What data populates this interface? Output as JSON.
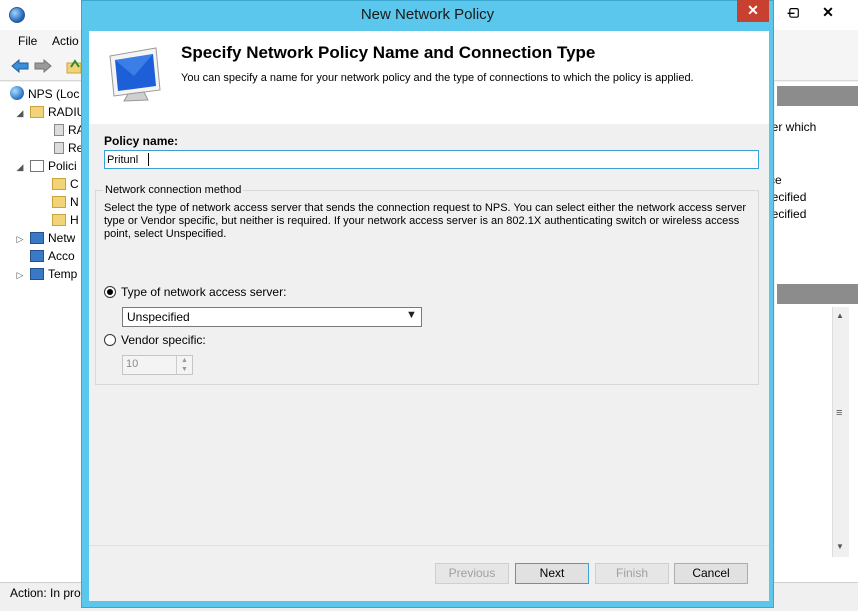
{
  "background_app": {
    "menu": [
      "File",
      "Actio"
    ],
    "tree": [
      {
        "label": "NPS (Loc",
        "icon": "globe"
      },
      {
        "label": "RADIU",
        "icon": "folder"
      },
      {
        "label": "RA",
        "icon": "server"
      },
      {
        "label": "Re",
        "icon": "server"
      },
      {
        "label": "Polici",
        "icon": "doc"
      },
      {
        "label": "C",
        "icon": "folder"
      },
      {
        "label": "N",
        "icon": "folder"
      },
      {
        "label": "H",
        "icon": "folder"
      },
      {
        "label": "Netw",
        "icon": "net"
      },
      {
        "label": "Acco",
        "icon": "net"
      },
      {
        "label": "Temp",
        "icon": "net"
      }
    ],
    "right_pane": {
      "line1": "der which",
      "col_header": "rce",
      "row1": "pecified",
      "row2": "pecified"
    },
    "status": "Action:  In pro"
  },
  "dialog": {
    "title": "New Network Policy",
    "close_glyph": "✕",
    "header_title": "Specify Network Policy Name and Connection Type",
    "header_desc": "You can specify a name for your network policy and the type of connections to which the policy is applied.",
    "policy_name_label": "Policy name:",
    "policy_name_value": "Pritunl",
    "group_title": "Network connection method",
    "group_desc": "Select the type of network access server that sends the connection request to NPS. You can select either the network access server type or Vendor specific, but neither is required.  If your network access server is an 802.1X authenticating switch or wireless access point, select Unspecified.",
    "radio_type_label": "Type of network access server:",
    "type_selected": "Unspecified",
    "radio_vendor_label": "Vendor specific:",
    "vendor_value": "10",
    "buttons": {
      "previous": "Previous",
      "next": "Next",
      "finish": "Finish",
      "cancel": "Cancel"
    }
  },
  "colors": {
    "dialog_frame": "#5bc7ec",
    "close_button": "#c8402f",
    "focus_border": "#3c9fd6"
  }
}
